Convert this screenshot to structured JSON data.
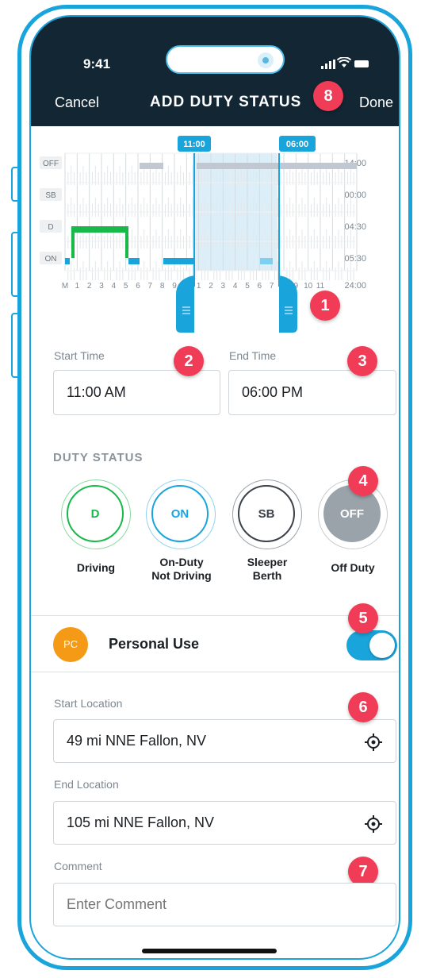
{
  "status_bar": {
    "time": "9:41"
  },
  "nav": {
    "cancel": "Cancel",
    "title": "ADD DUTY STATUS",
    "done": "Done"
  },
  "markers": [
    "1",
    "2",
    "3",
    "4",
    "5",
    "6",
    "7",
    "8"
  ],
  "graph": {
    "row_labels": [
      "OFF",
      "SB",
      "D",
      "ON"
    ],
    "row_totals": [
      "14:00",
      "00:00",
      "04:30",
      "05:30"
    ],
    "total": "24:00",
    "hour_labels": [
      "M",
      "1",
      "2",
      "3",
      "4",
      "5",
      "6",
      "7",
      "8",
      "9",
      "N",
      "1",
      "2",
      "3",
      "4",
      "5",
      "6",
      "7",
      "8",
      "9",
      "10",
      "11"
    ],
    "start_flag": "11:00",
    "end_flag": "06:00"
  },
  "times": {
    "start_label": "Start Time",
    "start_value": "11:00 AM",
    "end_label": "End Time",
    "end_value": "06:00 PM"
  },
  "duty": {
    "section_title": "DUTY STATUS",
    "options": [
      {
        "code": "D",
        "label_1": "Driving",
        "label_2": "",
        "color": "#18b84a"
      },
      {
        "code": "ON",
        "label_1": "On-Duty",
        "label_2": "Not Driving",
        "color": "#1aa4dc"
      },
      {
        "code": "SB",
        "label_1": "Sleeper",
        "label_2": "Berth",
        "color": "#3b4148"
      },
      {
        "code": "OFF",
        "label_1": "Off Duty",
        "label_2": "",
        "color": "#9aa3aa"
      }
    ]
  },
  "personal_use": {
    "badge": "PC",
    "label": "Personal Use",
    "enabled": true
  },
  "locations": {
    "start_label": "Start Location",
    "start_value": "49 mi NNE Fallon, NV",
    "end_label": "End Location",
    "end_value": "105 mi NNE Fallon, NV"
  },
  "comment": {
    "label": "Comment",
    "placeholder": "Enter Comment"
  },
  "colors": {
    "accent": "#1aa4dc",
    "header_bg": "#132634",
    "marker": "#f03c57",
    "driving": "#18b84a",
    "off_gray": "#c1c8d2"
  }
}
